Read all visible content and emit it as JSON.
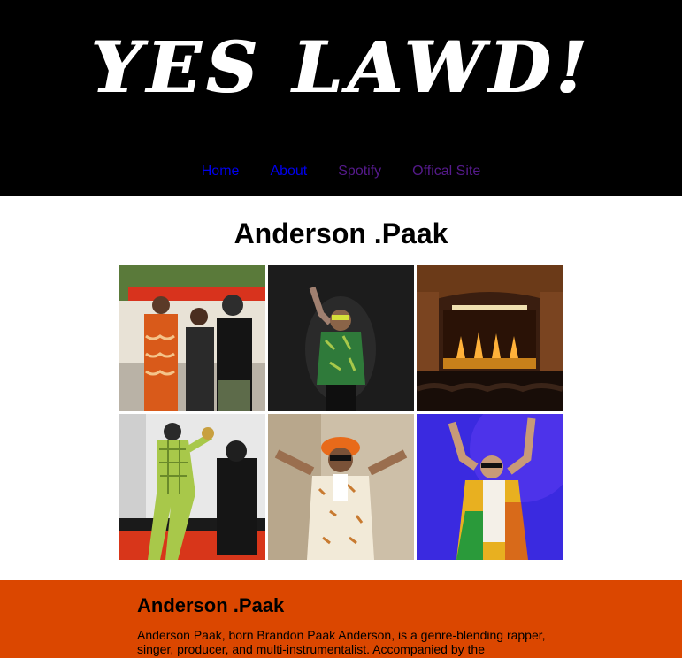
{
  "header": {
    "title": "YES LAWD!",
    "nav": [
      {
        "label": "Home",
        "state": "unvisited"
      },
      {
        "label": "About",
        "state": "unvisited"
      },
      {
        "label": "Spotify",
        "state": "visited"
      },
      {
        "label": "Offical Site",
        "state": "visited"
      }
    ]
  },
  "main": {
    "title": "Anderson .Paak"
  },
  "bio": {
    "title": "Anderson .Paak",
    "text": "Anderson Paak, born Brandon Paak Anderson, is a genre-blending rapper, singer, producer, and multi-instrumentalist. Accompanied by the"
  },
  "colors": {
    "header_bg": "#000000",
    "bio_bg": "#db4700",
    "link": "#0000ee",
    "link_visited": "#551a8b"
  }
}
